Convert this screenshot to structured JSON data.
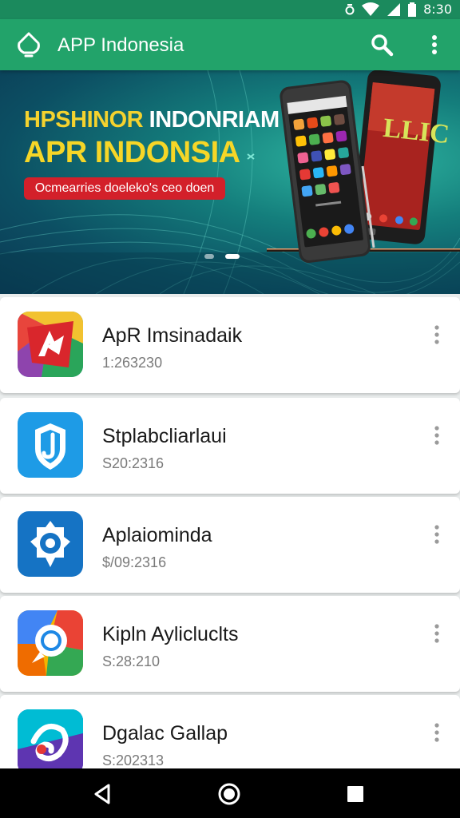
{
  "status_bar": {
    "time": "8:30"
  },
  "app_bar": {
    "title": "APP Indonesia"
  },
  "banner": {
    "headline_yellow": "HPSHINOR",
    "headline_white": "INDONRIAM",
    "headline_main": "APR INDONSIA",
    "pill": "Ocmearries doeleko's ceo doen",
    "phone_screen_text": "LLIC",
    "page_count": 2,
    "active_page": 2
  },
  "apps": [
    {
      "name": "ApR Imsinadaik",
      "meta": "1:263230"
    },
    {
      "name": "Stplabcliarlaui",
      "meta": "S20:2316"
    },
    {
      "name": "Aplaiominda",
      "meta": "$/09:2316"
    },
    {
      "name": "Kipln Aylicluclts",
      "meta": "S:28:210"
    },
    {
      "name": "Dgalac Gallap",
      "meta": "S:202313"
    }
  ],
  "colors": {
    "status_bar": "#1b8a5d",
    "app_bar": "#22a36a",
    "banner_accent": "#f4d22e",
    "pill": "#d3202a",
    "nav_bar": "#000000"
  },
  "icons": {
    "app_bar": [
      "app-logo-icon",
      "search-icon",
      "more-vert-icon"
    ],
    "nav_bar": [
      "back-icon",
      "home-icon",
      "recents-icon"
    ]
  }
}
